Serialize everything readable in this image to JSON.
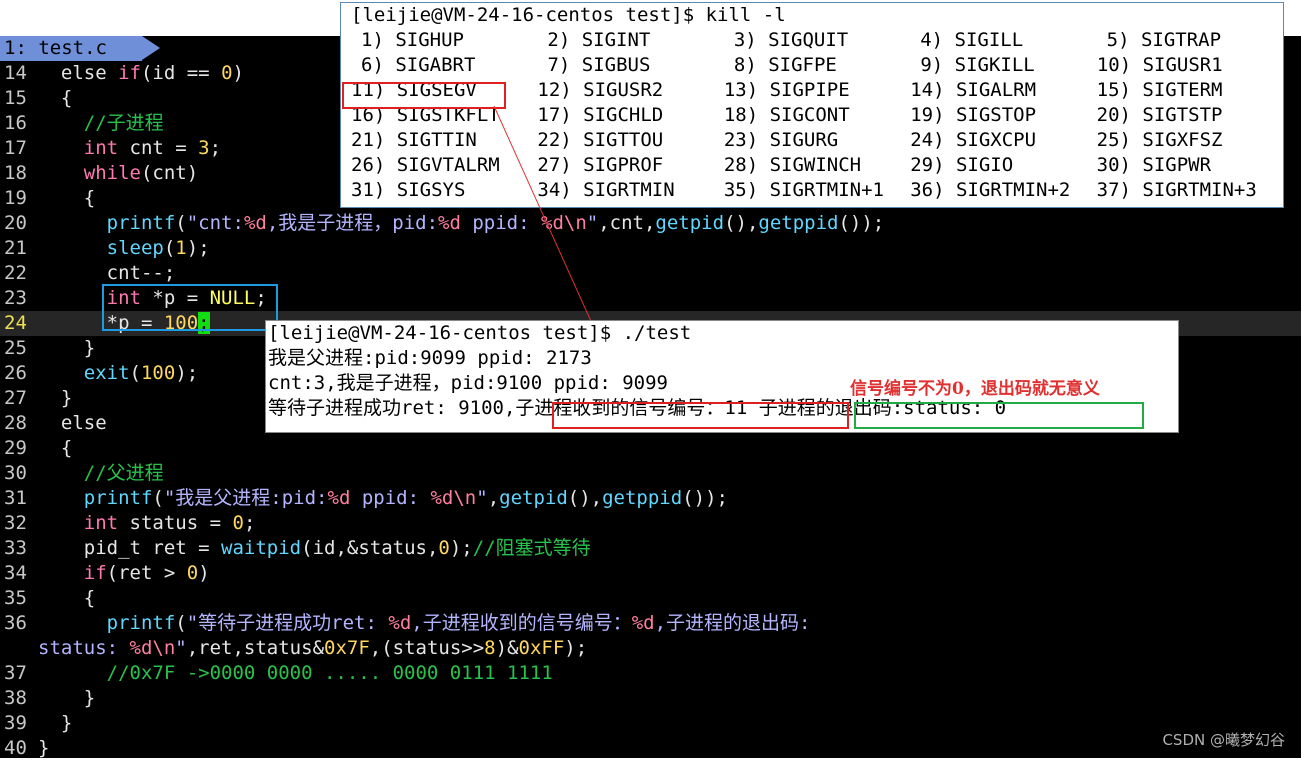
{
  "tab": {
    "label": "1: test.c"
  },
  "code_lines": [
    {
      "no": "14"
    },
    {
      "no": "15"
    },
    {
      "no": "16"
    },
    {
      "no": "17"
    },
    {
      "no": "18"
    },
    {
      "no": "19"
    },
    {
      "no": "20"
    },
    {
      "no": "21"
    },
    {
      "no": "22"
    },
    {
      "no": "23"
    },
    {
      "no": "24"
    },
    {
      "no": "25"
    },
    {
      "no": "26"
    },
    {
      "no": "27"
    },
    {
      "no": "28"
    },
    {
      "no": "29"
    },
    {
      "no": "30"
    },
    {
      "no": "31"
    },
    {
      "no": "32"
    },
    {
      "no": "33"
    },
    {
      "no": "34"
    },
    {
      "no": "35"
    },
    {
      "no": "36"
    },
    {
      "no": "37"
    },
    {
      "no": "38"
    },
    {
      "no": "39"
    },
    {
      "no": "40"
    }
  ],
  "code": {
    "l14a": "else ",
    "l14b": "if",
    "l14c": "(id == ",
    "l14d": "0",
    "l14e": ")",
    "l15": "{",
    "l16": "//子进程",
    "l17a": "int",
    "l17b": " cnt = ",
    "l17c": "3",
    "l17d": ";",
    "l18a": "while",
    "l18b": "(cnt)",
    "l19": "{",
    "l20a": "printf",
    "l20b": "(",
    "l20c": "\"cnt:",
    "l20d": "%d",
    "l20e": ",我是子进程，pid:",
    "l20f": "%d",
    "l20g": " ppid: ",
    "l20h": "%d\\n",
    "l20i": "\"",
    "l20j": ",cnt,",
    "l20k": "getpid",
    "l20l": "(),",
    "l20m": "getppid",
    "l20n": "());",
    "l21a": "sleep",
    "l21b": "(",
    "l21c": "1",
    "l21d": ");",
    "l22": "cnt--;",
    "l23a": "int",
    "l23b": " *p = ",
    "l23c": "NULL",
    "l23d": ";",
    "l24a": "*p = ",
    "l24b": "100",
    "l24c": ";",
    "l25": "}",
    "l26a": "exit",
    "l26b": "(",
    "l26c": "100",
    "l26d": ");",
    "l27": "}",
    "l28": "else",
    "l29": "{",
    "l30": "//父进程",
    "l31a": "printf",
    "l31b": "(",
    "l31c": "\"我是父进程:pid:",
    "l31d": "%d",
    "l31e": " ppid: ",
    "l31f": "%d\\n",
    "l31g": "\"",
    "l31h": ",",
    "l31i": "getpid",
    "l31j": "(),",
    "l31k": "getppid",
    "l31l": "());",
    "l32a": "int",
    "l32b": " status = ",
    "l32c": "0",
    "l32d": ";",
    "l33a": "pid_t ret = ",
    "l33b": "waitpid",
    "l33c": "(id,&status,",
    "l33d": "0",
    "l33e": ");",
    "l33f": "//阻塞式等待",
    "l34a": "if",
    "l34b": "(ret > ",
    "l34c": "0",
    "l34d": ")",
    "l35": "{",
    "l36a": "printf",
    "l36b": "(",
    "l36c": "\"等待子进程成功ret: ",
    "l36d": "%d",
    "l36e": ",子进程收到的信号编号：",
    "l36f": "%d",
    "l36g": ",子进程的退出码:",
    "l36w1": "status: ",
    "l36w2": "%d\\n",
    "l36w3": "\"",
    "l36w4": ",ret,status&",
    "l36w5": "0x7F",
    "l36w6": ",(status>>",
    "l36w7": "8",
    "l36w8": ")&",
    "l36w9": "0xFF",
    "l36w10": ");",
    "l37": "//0x7F ->0000 0000 ..... 0000 0111 1111",
    "l38": "}",
    "l39": "}",
    "l40": "}"
  },
  "term1": {
    "prompt": "[leijie@VM-24-16-centos test]$ kill -l",
    "rows": [
      [
        "1) SIGHUP",
        "2) SIGINT",
        "3) SIGQUIT",
        "4) SIGILL",
        "5) SIGTRAP"
      ],
      [
        "6) SIGABRT",
        "7) SIGBUS",
        "8) SIGFPE",
        "9) SIGKILL",
        "10) SIGUSR1"
      ],
      [
        "11) SIGSEGV",
        "12) SIGUSR2",
        "13) SIGPIPE",
        "14) SIGALRM",
        "15) SIGTERM"
      ],
      [
        "16) SIGSTKFLT",
        "17) SIGCHLD",
        "18) SIGCONT",
        "19) SIGSTOP",
        "20) SIGTSTP"
      ],
      [
        "21) SIGTTIN",
        "22) SIGTTOU",
        "23) SIGURG",
        "24) SIGXCPU",
        "25) SIGXFSZ"
      ],
      [
        "26) SIGVTALRM",
        "27) SIGPROF",
        "28) SIGWINCH",
        "29) SIGIO",
        "30) SIGPWR"
      ],
      [
        "31) SIGSYS",
        "34) SIGRTMIN",
        "35) SIGRTMIN+1",
        "36) SIGRTMIN+2",
        "37) SIGRTMIN+3"
      ]
    ]
  },
  "term2": {
    "prompt": "[leijie@VM-24-16-centos test]$ ./test",
    "line1": "我是父进程:pid:9099 ppid: 2173",
    "line2": "cnt:3,我是子进程，pid:9100 ppid: 9099",
    "line3a": "等待子进程成功ret: 9100,",
    "line3b": "子进程收到的信号编号：11",
    "line3c": "子进程的退出码:status: 0"
  },
  "annotation": "信号编号不为0，退出码就无意义",
  "watermark": "CSDN @曦梦幻谷",
  "colors": {
    "red_box": "#e02020",
    "blue_box": "#1e9be0",
    "green_box": "#22aa44"
  }
}
